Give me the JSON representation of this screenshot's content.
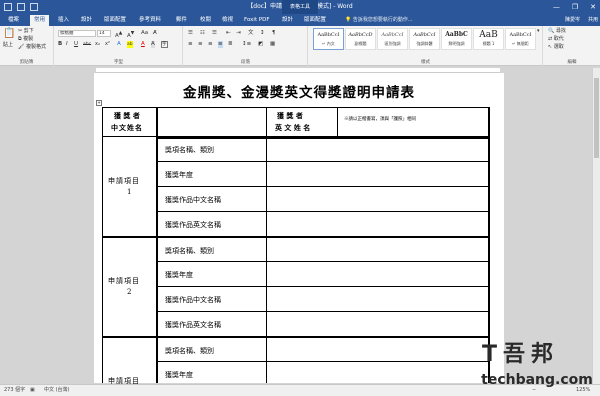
{
  "window": {
    "title": "【doc】申請表.doc [相容模式] - Word",
    "table_tools": "表格工具",
    "minimize": "—",
    "restore": "❐",
    "close": "✕"
  },
  "tabs": {
    "items": [
      {
        "label": "檔案"
      },
      {
        "label": "常用"
      },
      {
        "label": "插入"
      },
      {
        "label": "設計"
      },
      {
        "label": "版面配置"
      },
      {
        "label": "參考資料"
      },
      {
        "label": "郵件"
      },
      {
        "label": "校閱"
      },
      {
        "label": "檢視"
      },
      {
        "label": "Foxit PDF"
      },
      {
        "label": "設計"
      },
      {
        "label": "版面配置"
      }
    ],
    "tell_me": "告訴我您想要執行的動作...",
    "user": "陳愛岑",
    "share": "共用"
  },
  "ribbon": {
    "clipboard": {
      "paste": "貼上",
      "cut": "剪下",
      "copy": "複製",
      "format_painter": "複製格式",
      "label": "剪貼簿"
    },
    "font": {
      "name": "標楷體",
      "size": "14",
      "label": "字型",
      "bold": "B",
      "italic": "I",
      "underline": "U",
      "strike": "abc",
      "sub": "x₂",
      "sup": "x²",
      "font_color": "A",
      "highlight": "ab"
    },
    "paragraph": {
      "label": "段落"
    },
    "styles": {
      "label": "樣式",
      "items": [
        {
          "preview": "AaBbCcI",
          "name": "↵ 內文"
        },
        {
          "preview": "AaBbCcD",
          "name": "副標題"
        },
        {
          "preview": "AaBbCcI",
          "name": "區別強調"
        },
        {
          "preview": "AaBbCcI",
          "name": "強調斜體"
        },
        {
          "preview": "AaBbC",
          "name": "鮮明強調"
        },
        {
          "preview": "AaB",
          "name": "標題 1"
        },
        {
          "preview": "AaBbCcI",
          "name": "↵ 無間距"
        }
      ]
    },
    "editing": {
      "find": "尋找",
      "replace": "取代",
      "select": "選取",
      "label": "編輯"
    }
  },
  "document": {
    "title": "金鼎獎、金漫獎英文得獎證明申請表",
    "anchor": "+",
    "header": {
      "applicant_cn_line1": "獲  獎  者",
      "applicant_cn_line2": "中文姓名",
      "applicant_en_line1": "獲  獎  者",
      "applicant_en_line2": "英 文 姓 名",
      "note": "※請以正楷書寫，須與「護照」相同"
    },
    "items": [
      {
        "label": "申請項目",
        "number": "1",
        "fields": [
          "獎項名稱、類別",
          "獲獎年度",
          "獲獎作品中文名稱",
          "獲獎作品英文名稱"
        ]
      },
      {
        "label": "申請項目",
        "number": "2",
        "fields": [
          "獎項名稱、類別",
          "獲獎年度",
          "獲獎作品中文名稱",
          "獲獎作品英文名稱"
        ]
      },
      {
        "label": "申請項目",
        "number": "",
        "fields": [
          "獎項名稱、類別",
          "獲獎年度"
        ]
      }
    ]
  },
  "status": {
    "words": "273 個字",
    "language": "中文 (台灣)",
    "zoom": "125%"
  },
  "watermark": {
    "brand": "techbang.com"
  },
  "colors": {
    "word_blue": "#2b579a",
    "ribbon_bg": "#f3f3f3"
  }
}
